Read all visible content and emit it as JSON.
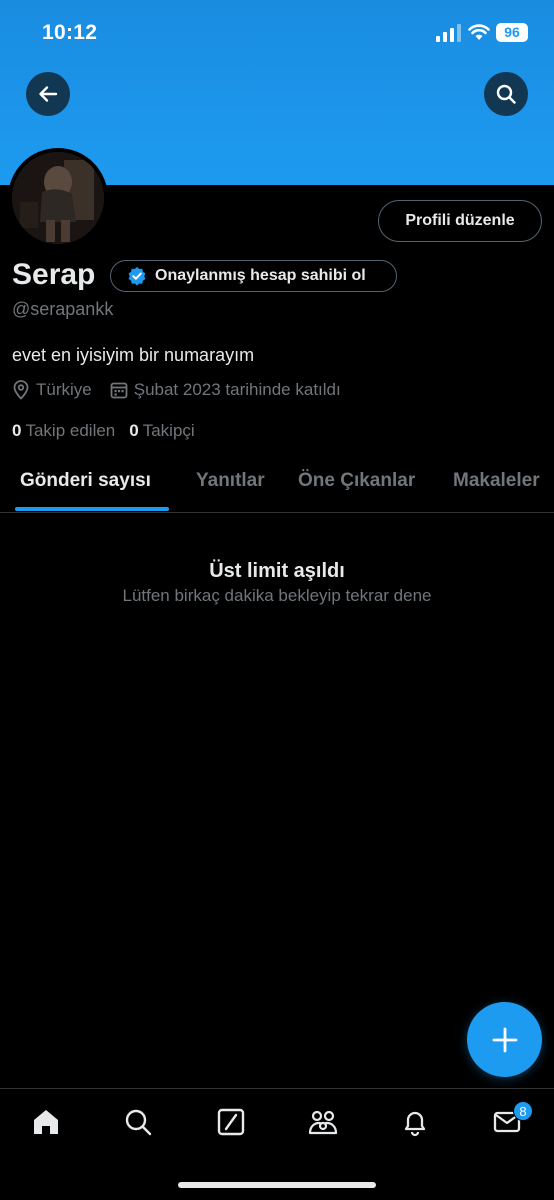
{
  "status_bar": {
    "time": "10:12",
    "battery": "96"
  },
  "profile": {
    "name": "Serap",
    "verify_label": "Onaylanmış hesap sahibi ol",
    "handle": "@serapankk",
    "bio": "evet en iyisiyim bir numarayım",
    "location": "Türkiye",
    "joined": "Şubat 2023 tarihinde katıldı",
    "following_count": "0",
    "following_label": "Takip edilen",
    "followers_count": "0",
    "followers_label": "Takipçi",
    "edit_button": "Profili düzenle"
  },
  "tabs": [
    {
      "label": "Gönderi sayısı",
      "active": true
    },
    {
      "label": "Yanıtlar",
      "active": false
    },
    {
      "label": "Öne Çıkanlar",
      "active": false
    },
    {
      "label": "Makaleler",
      "active": false
    }
  ],
  "empty_state": {
    "title": "Üst limit aşıldı",
    "subtitle": "Lütfen birkaç dakika bekleyip tekrar dene"
  },
  "bottom_nav": {
    "items": [
      "home-icon",
      "search-icon",
      "grok-icon",
      "communities-icon",
      "notifications-icon",
      "messages-icon"
    ],
    "messages_badge": "8"
  },
  "colors": {
    "accent": "#1d9bf0",
    "background": "#000000",
    "muted": "#71767b",
    "text": "#e7e9ea"
  }
}
